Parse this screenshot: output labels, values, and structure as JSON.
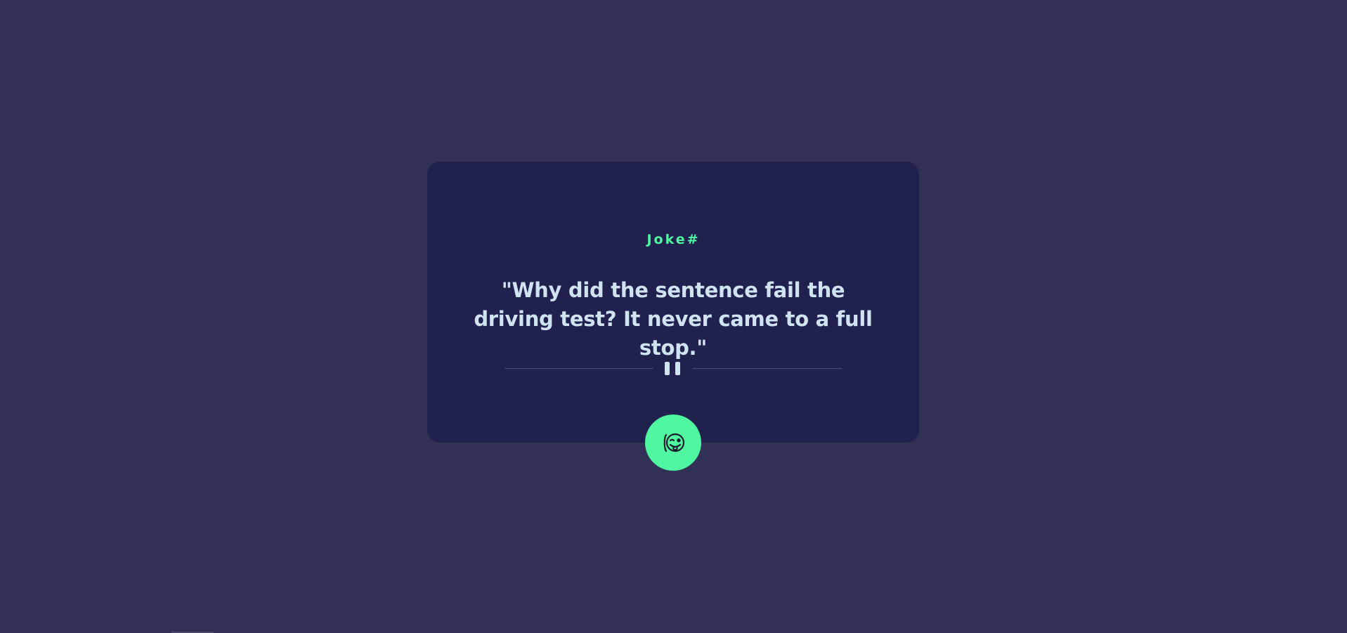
{
  "card": {
    "label": "Joke#",
    "text": "\"Why did the sentence fail the driving test? It never came to a full stop.\""
  },
  "icons": {
    "divider": "pause-icon",
    "button": "wink-tongue-face-icon"
  },
  "colors": {
    "background": "#313055",
    "card": "#212150",
    "accent": "#4ff7a1",
    "text": "#cfe3f1",
    "divider": "#4d5076"
  }
}
